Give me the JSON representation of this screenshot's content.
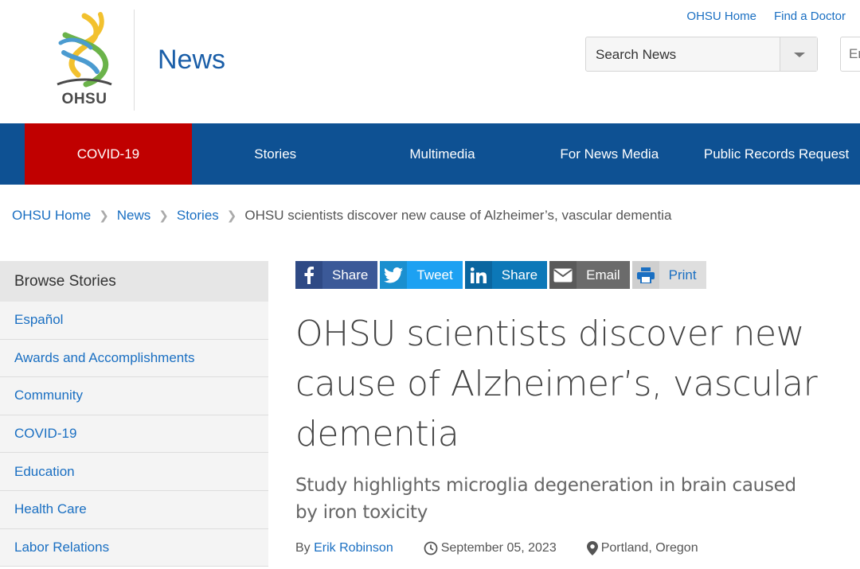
{
  "header": {
    "logo_text": "OHSU",
    "site_title": "News",
    "top_links": [
      "OHSU Home",
      "Find a Doctor"
    ],
    "search_select_label": "Search News",
    "search_input_placeholder": "Enter"
  },
  "nav": {
    "items": [
      "COVID-19",
      "Stories",
      "Multimedia",
      "For News Media",
      "Public Records Request"
    ],
    "active_color": "#c00000",
    "bar_color": "#0e5193"
  },
  "breadcrumb": {
    "links": [
      "OHSU Home",
      "News",
      "Stories"
    ],
    "current": "OHSU scientists discover new cause of Alzheimer’s, vascular dementia"
  },
  "sidebar": {
    "heading": "Browse Stories",
    "items": [
      "Español",
      "Awards and Accomplishments",
      "Community",
      "COVID-19",
      "Education",
      "Health Care",
      "Labor Relations"
    ]
  },
  "share": {
    "buttons": [
      {
        "icon": "facebook-icon",
        "label": "Share"
      },
      {
        "icon": "twitter-icon",
        "label": "Tweet"
      },
      {
        "icon": "linkedin-icon",
        "label": "Share"
      },
      {
        "icon": "email-icon",
        "label": "Email"
      },
      {
        "icon": "print-icon",
        "label": "Print"
      }
    ]
  },
  "article": {
    "title": "OHSU scientists discover new cause of Alzheimer’s, vascular dementia",
    "subtitle": "Study highlights microglia degeneration in brain caused by iron toxicity",
    "byline_prefix": "By",
    "author": "Erik Robinson",
    "date": "September 05, 2023",
    "location": "Portland, Oregon"
  }
}
